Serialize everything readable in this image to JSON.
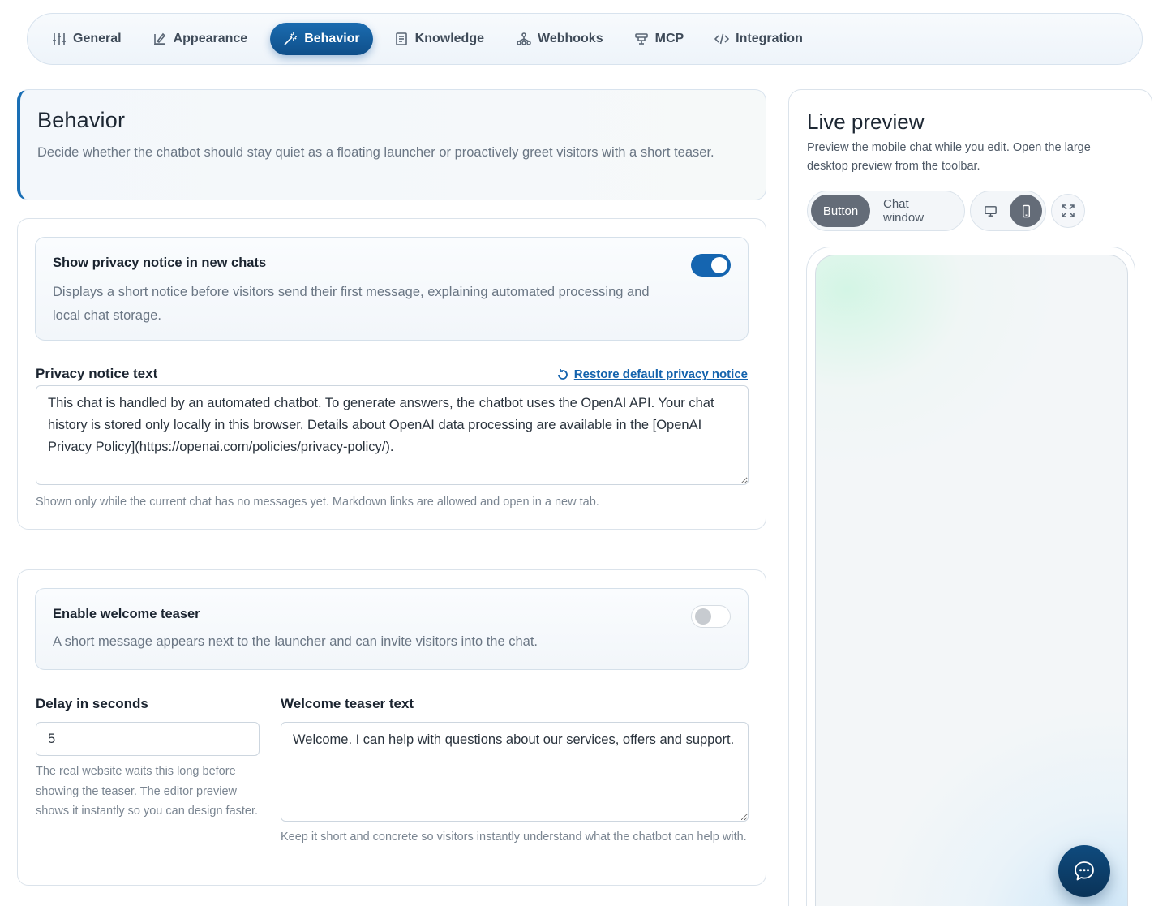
{
  "nav": {
    "tabs": [
      {
        "label": "General",
        "icon": "sliders-icon"
      },
      {
        "label": "Appearance",
        "icon": "edit-icon"
      },
      {
        "label": "Behavior",
        "icon": "magic-wand-icon",
        "active": true
      },
      {
        "label": "Knowledge",
        "icon": "book-icon"
      },
      {
        "label": "Webhooks",
        "icon": "network-icon"
      },
      {
        "label": "MCP",
        "icon": "server-icon"
      },
      {
        "label": "Integration",
        "icon": "code-icon"
      }
    ]
  },
  "section": {
    "title": "Behavior",
    "description": "Decide whether the chatbot should stay quiet as a floating launcher or proactively greet visitors with a short teaser."
  },
  "privacy": {
    "toggle_title": "Show privacy notice in new chats",
    "toggle_description": "Displays a short notice before visitors send their first message, explaining automated processing and local chat storage.",
    "enabled": true,
    "field_label": "Privacy notice text",
    "restore_label": "Restore default privacy notice",
    "text_value": "This chat is handled by an automated chatbot. To generate answers, the chatbot uses the OpenAI API. Your chat history is stored only locally in this browser. Details about OpenAI data processing are available in the [OpenAI Privacy Policy](https://openai.com/policies/privacy-policy/).",
    "hint": "Shown only while the current chat has no messages yet. Markdown links are allowed and open in a new tab."
  },
  "teaser": {
    "toggle_title": "Enable welcome teaser",
    "toggle_description": "A short message appears next to the launcher and can invite visitors into the chat.",
    "enabled": false,
    "delay_label": "Delay in seconds",
    "delay_value": "5",
    "delay_hint": "The real website waits this long before showing the teaser. The editor preview shows it instantly so you can design faster.",
    "text_label": "Welcome teaser text",
    "text_value": "Welcome. I can help with questions about our services, offers and support.",
    "text_hint": "Keep it short and concrete so visitors instantly understand what the chatbot can help with."
  },
  "preview": {
    "title": "Live preview",
    "description": "Preview the mobile chat while you edit. Open the large desktop preview from the toolbar.",
    "mode_options": [
      "Button",
      "Chat window"
    ],
    "selected_mode": "Button",
    "device_options": [
      "desktop-icon",
      "mobile-icon"
    ],
    "selected_device": "mobile-icon",
    "expand_icon": "expand-icon",
    "launcher_icon": "chat-bubble-icon"
  },
  "colors": {
    "accent": "#1565b0",
    "active_tab": "#1b6cb0",
    "launcher": "#0f4b7e"
  }
}
